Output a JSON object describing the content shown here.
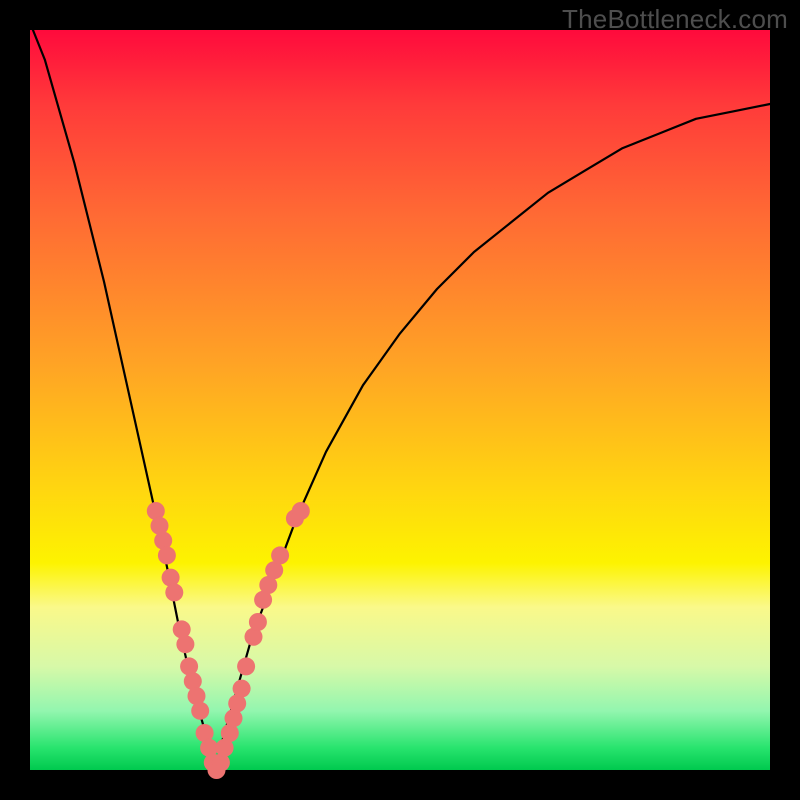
{
  "watermark": "TheBottleneck.com",
  "chart_data": {
    "type": "line",
    "title": "",
    "xlabel": "",
    "ylabel": "",
    "xlim": [
      0,
      100
    ],
    "ylim": [
      0,
      100
    ],
    "annotations": [],
    "series": [
      {
        "name": "bottleneck-curve",
        "x": [
          0,
          2,
          4,
          6,
          8,
          10,
          12,
          14,
          16,
          18,
          20,
          22,
          24,
          25,
          26,
          28,
          30,
          33,
          36,
          40,
          45,
          50,
          55,
          60,
          65,
          70,
          75,
          80,
          85,
          90,
          95,
          100
        ],
        "values": [
          101,
          96,
          89,
          82,
          74,
          66,
          57,
          48,
          39,
          30,
          20,
          11,
          4,
          0,
          4,
          11,
          18,
          26,
          34,
          43,
          52,
          59,
          65,
          70,
          74,
          78,
          81,
          84,
          86,
          88,
          89,
          90
        ]
      }
    ],
    "markers": [
      {
        "x": 17.0,
        "y": 35,
        "r": 9
      },
      {
        "x": 17.5,
        "y": 33,
        "r": 9
      },
      {
        "x": 18.0,
        "y": 31,
        "r": 9
      },
      {
        "x": 18.5,
        "y": 29,
        "r": 9
      },
      {
        "x": 19.0,
        "y": 26,
        "r": 9
      },
      {
        "x": 19.5,
        "y": 24,
        "r": 9
      },
      {
        "x": 20.5,
        "y": 19,
        "r": 9
      },
      {
        "x": 21.0,
        "y": 17,
        "r": 9
      },
      {
        "x": 21.5,
        "y": 14,
        "r": 9
      },
      {
        "x": 22.0,
        "y": 12,
        "r": 9
      },
      {
        "x": 22.5,
        "y": 10,
        "r": 9
      },
      {
        "x": 23.0,
        "y": 8,
        "r": 9
      },
      {
        "x": 23.6,
        "y": 5,
        "r": 9
      },
      {
        "x": 24.2,
        "y": 3,
        "r": 9
      },
      {
        "x": 24.7,
        "y": 1,
        "r": 9
      },
      {
        "x": 25.2,
        "y": 0,
        "r": 9
      },
      {
        "x": 25.8,
        "y": 1,
        "r": 9
      },
      {
        "x": 26.3,
        "y": 3,
        "r": 9
      },
      {
        "x": 27.0,
        "y": 5,
        "r": 9
      },
      {
        "x": 27.5,
        "y": 7,
        "r": 9
      },
      {
        "x": 28.0,
        "y": 9,
        "r": 9
      },
      {
        "x": 28.6,
        "y": 11,
        "r": 9
      },
      {
        "x": 29.2,
        "y": 14,
        "r": 9
      },
      {
        "x": 30.2,
        "y": 18,
        "r": 9
      },
      {
        "x": 30.8,
        "y": 20,
        "r": 9
      },
      {
        "x": 31.5,
        "y": 23,
        "r": 9
      },
      {
        "x": 32.2,
        "y": 25,
        "r": 9
      },
      {
        "x": 33.0,
        "y": 27,
        "r": 9
      },
      {
        "x": 33.8,
        "y": 29,
        "r": 9
      },
      {
        "x": 35.8,
        "y": 34,
        "r": 9
      },
      {
        "x": 36.6,
        "y": 35,
        "r": 9
      }
    ]
  }
}
